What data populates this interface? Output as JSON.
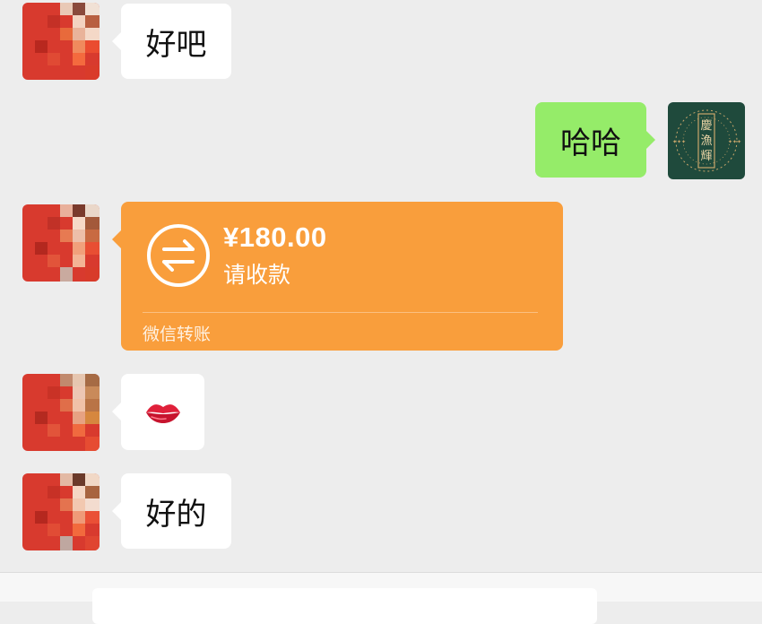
{
  "messages": [
    {
      "side": "left",
      "type": "text",
      "text": "好吧"
    },
    {
      "side": "right",
      "type": "text",
      "text": "哈哈"
    },
    {
      "side": "left",
      "type": "transfer",
      "amount": "¥180.00",
      "status": "请收款",
      "footer": "微信转账"
    },
    {
      "side": "left",
      "type": "emoji",
      "icon": "lips-emoji",
      "text": "👄"
    },
    {
      "side": "left",
      "type": "text",
      "text": "好的"
    }
  ],
  "my_avatar": {
    "text": "慶漁輝"
  },
  "colors": {
    "background": "#ededed",
    "my_bubble": "#95ec69",
    "their_bubble": "#ffffff",
    "transfer": "#f99e3c",
    "my_avatar_bg": "#1f4a3c",
    "my_avatar_gold": "#c9a66b"
  }
}
